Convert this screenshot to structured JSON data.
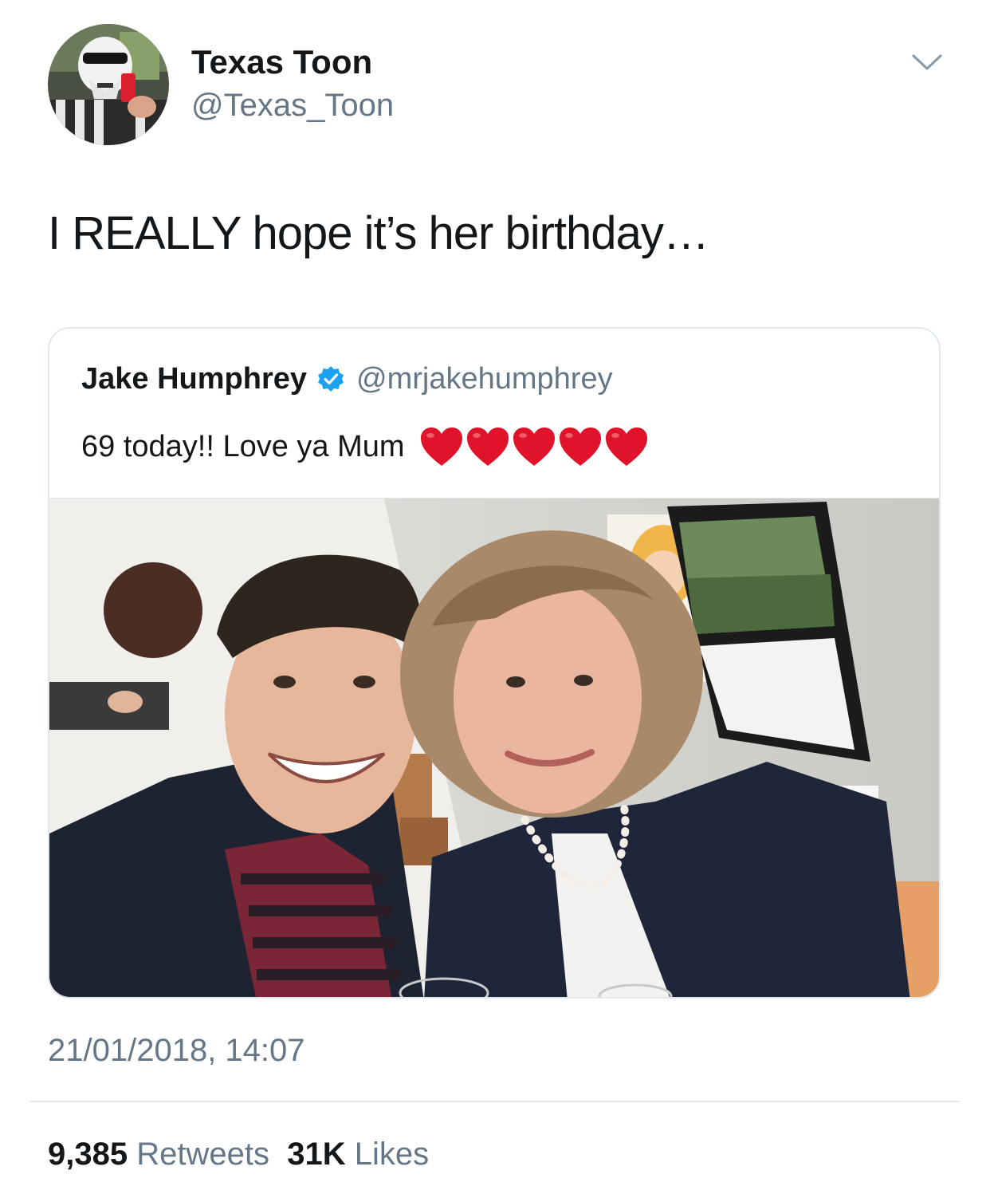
{
  "author": {
    "name": "Texas Toon",
    "handle": "@Texas_Toon",
    "avatar_icon": "avatar-stormtrooper-image"
  },
  "tweet": {
    "text": "I REALLY hope it’s her birthday…",
    "timestamp": "21/01/2018, 14:07"
  },
  "quoted_tweet": {
    "name": "Jake Humphrey",
    "verified": true,
    "handle": "@mrjakehumphrey",
    "text": "69 today!! Love ya Mum",
    "heart_count": 5,
    "photo_icon": "selfie-photo"
  },
  "stats": {
    "retweets_count": "9,385",
    "retweets_label": "Retweets",
    "likes_count": "31K",
    "likes_label": "Likes"
  },
  "colors": {
    "text_primary": "#14171a",
    "text_secondary": "#657786",
    "border": "#e1e8ed",
    "verified_blue": "#1da1f2",
    "heart_red": "#e0132a"
  }
}
